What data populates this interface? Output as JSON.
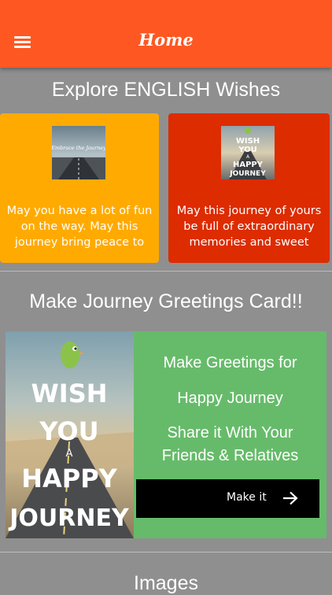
{
  "appbar": {
    "title": "Home",
    "color": "#ff5722"
  },
  "explore": {
    "title": "Explore ENGLISH Wishes",
    "cards": [
      {
        "color": "#ffaa00",
        "thumb_caption": "Embrace the Journey",
        "text": "May you have a lot of fun on the way. May this journey bring peace to"
      },
      {
        "color": "#dd2c00",
        "thumb_text": [
          "WISH",
          "YOU",
          "A",
          "HAPPY",
          "JOURNEY"
        ],
        "text": "May this journey of yours be full of extraordinary memories and sweet"
      }
    ]
  },
  "greeting": {
    "title": "Make Journey Greetings Card!!",
    "card_color": "#66bb6a",
    "art_text": [
      "WISH",
      "YOU",
      "A",
      "HAPPY",
      "JOURNEY"
    ],
    "lines": [
      "Make Greetings for",
      "Happy Journey",
      "Share it With Your",
      "Friends & Relatives"
    ],
    "button_label": "Make it"
  },
  "images": {
    "title": "Images"
  }
}
